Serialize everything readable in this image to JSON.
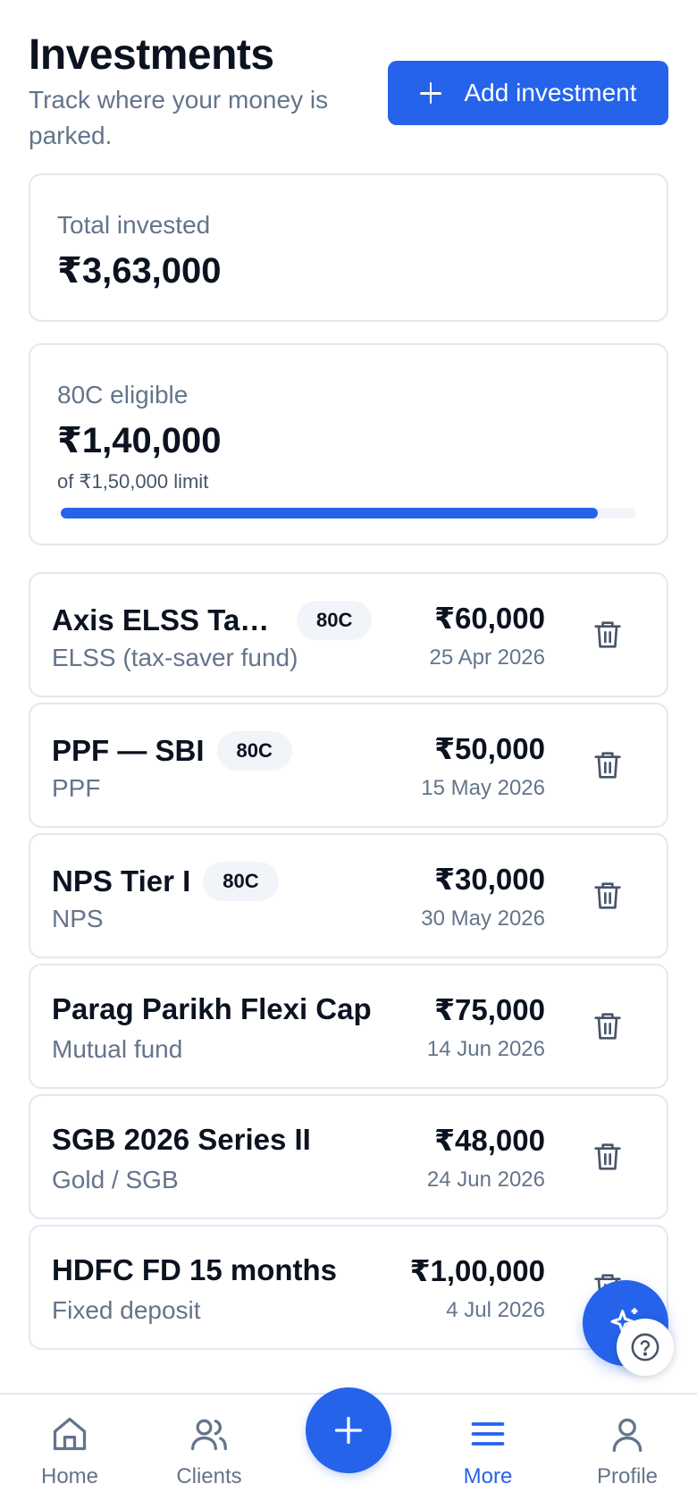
{
  "header": {
    "title": "Investments",
    "subtitle": "Track where your money is parked.",
    "add_button_label": "Add investment"
  },
  "summary": {
    "total": {
      "label": "Total invested",
      "value": "₹3,63,000"
    },
    "eligible": {
      "label": "80C eligible",
      "value": "₹1,40,000",
      "note": "of ₹1,50,000 limit",
      "progress_fraction": 0.933
    }
  },
  "investments": [
    {
      "name": "Axis ELSS Tax Saver Fund",
      "badge": "80C",
      "type": "ELSS (tax-saver fund)",
      "amount": "₹60,000",
      "date": "25 Apr 2026"
    },
    {
      "name": "PPF — SBI",
      "badge": "80C",
      "type": "PPF",
      "amount": "₹50,000",
      "date": "15 May 2026"
    },
    {
      "name": "NPS Tier I",
      "badge": "80C",
      "type": "NPS",
      "amount": "₹30,000",
      "date": "30 May 2026"
    },
    {
      "name": "Parag Parikh Flexi Cap",
      "badge": "",
      "type": "Mutual fund",
      "amount": "₹75,000",
      "date": "14 Jun 2026"
    },
    {
      "name": "SGB 2026 Series II",
      "badge": "",
      "type": "Gold / SGB",
      "amount": "₹48,000",
      "date": "24 Jun 2026"
    },
    {
      "name": "HDFC FD 15 months",
      "badge": "",
      "type": "Fixed deposit",
      "amount": "₹1,00,000",
      "date": "4 Jul 2026"
    }
  ],
  "nav": {
    "home": "Home",
    "clients": "Clients",
    "more": "More",
    "profile": "Profile",
    "active": "more"
  },
  "icons": {
    "add": "plus-icon",
    "delete": "trash-icon",
    "assistant": "sparkles-icon",
    "help": "help-circle-icon"
  },
  "colors": {
    "accent": "#2563eb",
    "muted_text": "#64748b",
    "border": "#e2e8f0"
  }
}
